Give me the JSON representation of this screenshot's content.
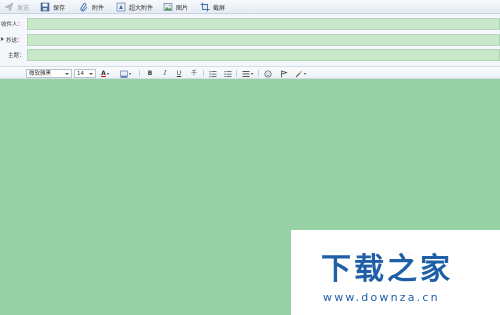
{
  "toolbar": {
    "send_label": "发送",
    "save_label": "保存",
    "attach_label": "附件",
    "big_attach_label": "超大附件",
    "image_label": "图片",
    "screenshot_label": "截屏"
  },
  "fields": {
    "to_label": "收件人：",
    "cc_label": "抄送：",
    "subject_label": "主题：",
    "to_value": "",
    "cc_value": "",
    "subject_value": ""
  },
  "format": {
    "font_family": "微软雅黑",
    "font_size": "14",
    "bold_label": "B",
    "italic_label": "I",
    "underline_label": "U",
    "strike_label": "千"
  },
  "colors": {
    "editor_bg": "#97d2a6",
    "field_bg": "#c8e8c9",
    "accent": "#1f5fa8"
  },
  "watermark": {
    "title": "下载之家",
    "url": "www.downza.cn"
  }
}
